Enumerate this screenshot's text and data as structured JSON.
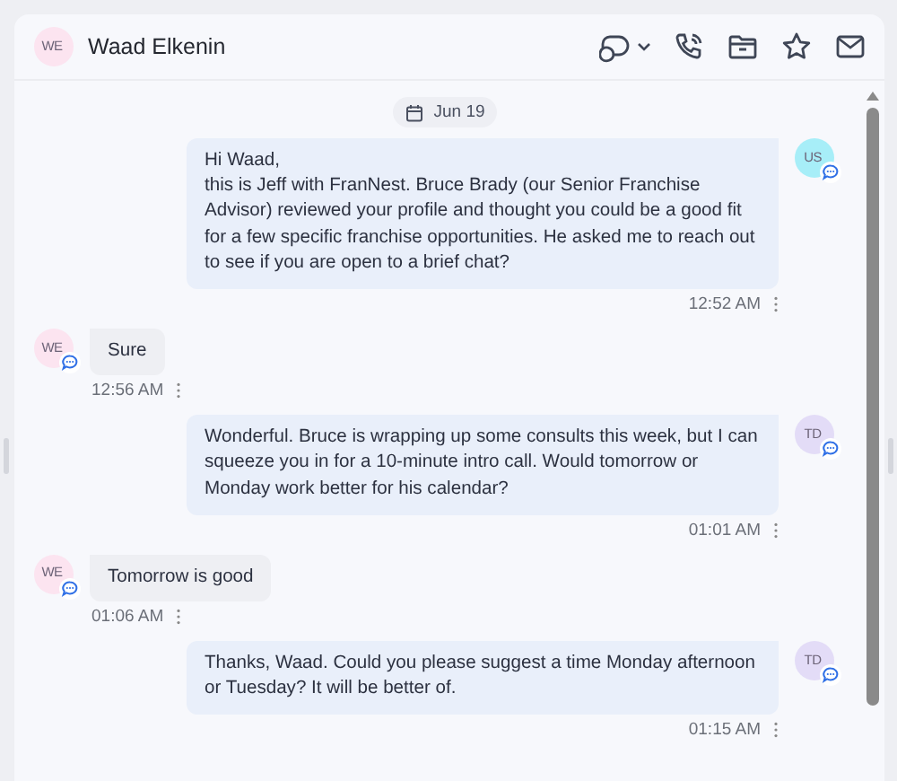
{
  "contact": {
    "initials": "WE",
    "name": "Waad Elkenin",
    "color": "#fce4f0"
  },
  "date": "Jun 19",
  "messages": [
    {
      "kind": "outgoing",
      "initials": "US",
      "color": "#a7eef8",
      "text": "Hi Waad,\nthis is Jeff with FranNest. Bruce Brady (our Senior Franchise Advisor) reviewed your profile and thought you could be a good fit for a few specific franchise opportunities. He asked me to reach out to see if you are open to a brief chat?",
      "time": "12:52 AM"
    },
    {
      "kind": "incoming",
      "initials": "WE",
      "color": "#fce4f0",
      "text": "Sure",
      "time": "12:56 AM"
    },
    {
      "kind": "outgoing",
      "initials": "TD",
      "color": "#e3dcf7",
      "text": "Wonderful. Bruce is wrapping up some consults this week, but I can squeeze you in for a 10-minute intro call. Would tomorrow or Monday work better for his calendar?",
      "time": "01:01 AM"
    },
    {
      "kind": "incoming",
      "initials": "WE",
      "color": "#fce4f0",
      "text": "Tomorrow is good",
      "time": "01:06 AM"
    },
    {
      "kind": "outgoing",
      "initials": "TD",
      "color": "#e3dcf7",
      "text": "Thanks, Waad. Could you please suggest a time Monday afternoon or Tuesday? It will be better of.",
      "time": "01:15 AM"
    }
  ]
}
